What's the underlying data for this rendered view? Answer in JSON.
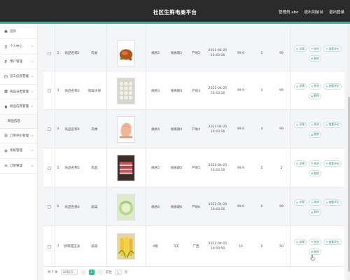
{
  "header": {
    "title": "社区生鲜电商平台",
    "admin_label": "管理员 abo",
    "exit_label": "退出到前台",
    "logout_label": "退出登录"
  },
  "colors": {
    "accent": "#2fb89a",
    "topbar": "#2b2b2b"
  },
  "sidebar": {
    "items": [
      {
        "label": "首页",
        "icon": "home-icon"
      },
      {
        "label": "个人中心",
        "icon": "user-icon",
        "chevron": true
      },
      {
        "label": "用户管理",
        "icon": "users-icon",
        "chevron": true
      },
      {
        "label": "员工信息管理",
        "icon": "staff-icon",
        "chevron": true
      },
      {
        "label": "商品分类管理",
        "icon": "category-icon",
        "chevron": true
      },
      {
        "label": "商品信息管理",
        "icon": "goods-icon",
        "chevron": true,
        "expanded": true
      },
      {
        "label": "订单评价管理",
        "icon": "order-icon",
        "chevron": true
      },
      {
        "label": "系统管理",
        "icon": "system-icon",
        "chevron": true
      },
      {
        "label": "订单管理",
        "icon": "list-icon",
        "chevron": true
      }
    ],
    "sub_item": "商品信息"
  },
  "table": {
    "rows": [
      {
        "no": "2",
        "name": "商品名称2",
        "category": "肉食",
        "image": "roast-chicken",
        "spec": "规格2",
        "bag": "保质期2",
        "origin": "产地2",
        "date": "2021-04-25",
        "time": "10:43:16",
        "price": "99.9",
        "stock": "2",
        "num": "99"
      },
      {
        "no": "3",
        "name": "商品名称3",
        "category": "新鲜水果",
        "image": "eggs",
        "spec": "规格3",
        "bag": "保质期3",
        "origin": "产地3",
        "date": "2021-04-25",
        "time": "10:43:16",
        "price": "99.9",
        "stock": "3",
        "num": "99"
      },
      {
        "no": "4",
        "name": "商品名称4",
        "category": "肉类",
        "image": "raw-chicken",
        "spec": "规格4",
        "bag": "保质期4",
        "origin": "产地4",
        "date": "2021-04-25",
        "time": "10:43:16",
        "price": "99.9",
        "stock": "4",
        "num": "99"
      },
      {
        "no": "5",
        "name": "商品名称5",
        "category": "肉品",
        "image": "pork-belly",
        "spec": "规格5",
        "bag": "保质期5",
        "origin": "产地5",
        "date": "2021-04-25",
        "time": "10:43:16",
        "price": "99.9",
        "stock": "5",
        "num": "2"
      },
      {
        "no": "6",
        "name": "商品名称6",
        "category": "蔬菜",
        "image": "cabbage",
        "spec": "规格6",
        "bag": "保质期6",
        "origin": "产地6",
        "date": "2021-04-25",
        "time": "10:43:16",
        "price": "99.9",
        "stock": "6",
        "num": "99"
      },
      {
        "no": "7",
        "name": "新鲜甜玉米",
        "category": "蔬菜",
        "image": "corn",
        "spec": "4根",
        "bag": "5天",
        "origin": "广西",
        "date": "2021-04-25",
        "time": "10:50:50",
        "price": "15",
        "stock": "5",
        "num": "50"
      }
    ],
    "actions": {
      "detail": "详情",
      "edit": "修改",
      "review": "查看评论",
      "delete": "删除"
    }
  },
  "pagination": {
    "total": "共 7 条",
    "page_size": "10条/页",
    "prev": "‹",
    "current_page": "1",
    "next": "›",
    "goto_label": "前往",
    "goto_value": "1",
    "page_suffix": "页"
  }
}
